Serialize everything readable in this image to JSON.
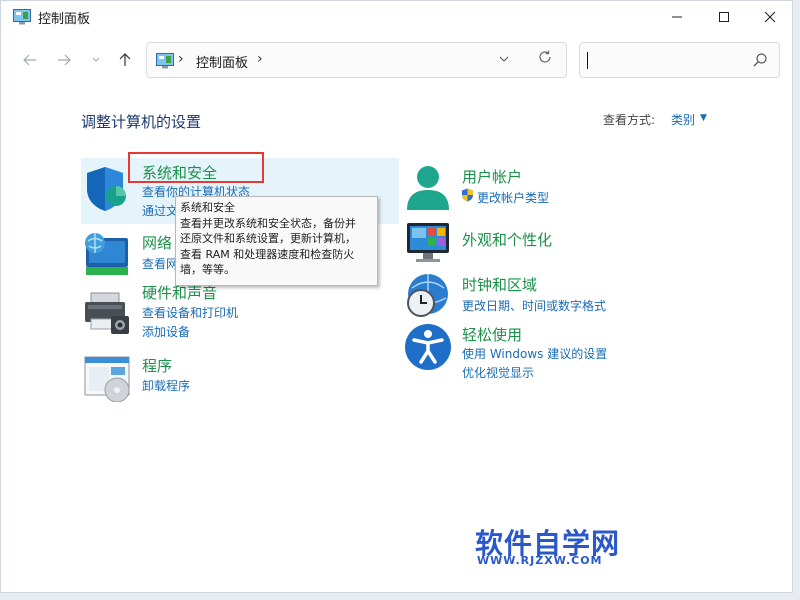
{
  "window": {
    "title": "控制面板"
  },
  "address": {
    "path": "控制面板"
  },
  "search": {
    "placeholder": ""
  },
  "header": {
    "heading": "调整计算机的设置",
    "view_by_label": "查看方式:",
    "view_by_value": "类别"
  },
  "categories": {
    "system_security": {
      "title": "系统和安全",
      "link1": "查看你的计算机状态",
      "link2": "通过文"
    },
    "network": {
      "title": "网络",
      "link1": "查看网"
    },
    "hardware": {
      "title": "硬件和声音",
      "link1": "查看设备和打印机",
      "link2": "添加设备"
    },
    "programs": {
      "title": "程序",
      "link1": "卸载程序"
    },
    "user_accounts": {
      "title": "用户帐户",
      "link1": "更改帐户类型"
    },
    "appearance": {
      "title": "外观和个性化"
    },
    "clock_region": {
      "title": "时钟和区域",
      "link1": "更改日期、时间或数字格式"
    },
    "ease_access": {
      "title": "轻松使用",
      "link1": "使用 Windows 建议的设置",
      "link2": "优化视觉显示"
    }
  },
  "tooltip": {
    "title": "系统和安全",
    "line1": "查看并更改系统和安全状态，备份并",
    "line2": "还原文件和系统设置，更新计算机，",
    "line3": "查看 RAM 和处理器速度和检查防火",
    "line4": "墙，等等。"
  },
  "watermark": {
    "title": "软件自学网",
    "url": "WWW.RJZXW.COM"
  },
  "colors": {
    "category_green": "#1a9148",
    "link_blue": "#1a6bb5",
    "heading_navy": "#1e3a6e",
    "highlight_red": "#e53935",
    "hover_bg": "#e5f3fb",
    "watermark_blue": "#2a57c9"
  }
}
